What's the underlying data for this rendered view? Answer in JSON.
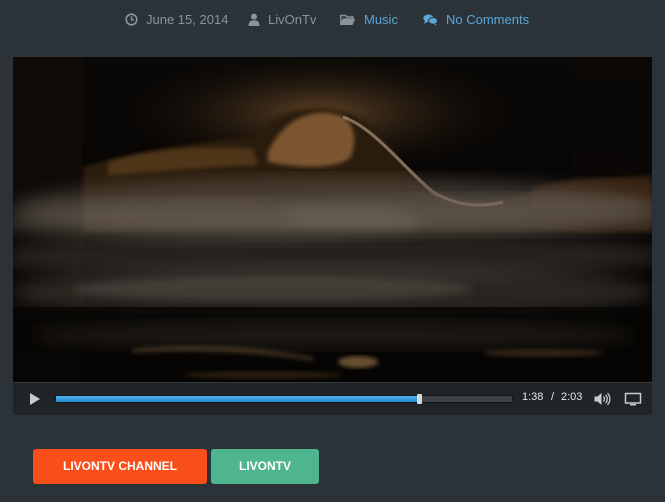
{
  "meta": {
    "date": "June 15, 2014",
    "author": "LivOnTv",
    "category": "Music",
    "comments": "No Comments",
    "icons": {
      "date": "clock-icon",
      "author": "user-icon",
      "category": "folder-icon",
      "comments": "comments-icon"
    }
  },
  "video": {
    "current_time": "1:38",
    "time_separator": "/",
    "duration": "2:03",
    "progress_percent": 79.7,
    "controls": {
      "play": "play-icon",
      "volume": "volume-icon",
      "fullscreen": "fullscreen-icon"
    }
  },
  "buttons": [
    {
      "label": "LIVONTV CHANNEL",
      "color": "#f9501b"
    },
    {
      "label": "LIVONTV",
      "color": "#4fb58f"
    }
  ],
  "colors": {
    "background": "#2b3339",
    "meta_text": "#8b949b",
    "link": "#5aa7d8",
    "progress": "#2a95e0"
  }
}
